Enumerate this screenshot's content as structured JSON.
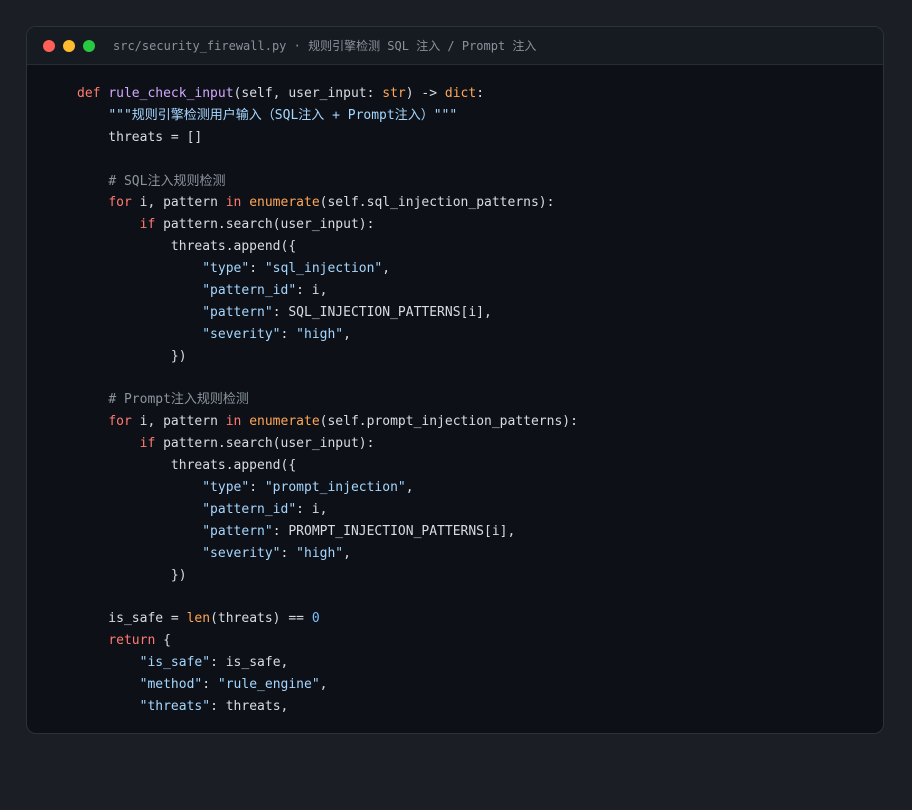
{
  "window": {
    "title": "src/security_firewall.py · 规则引擎检测 SQL 注入 / Prompt 注入",
    "controls": [
      {
        "name": "close-dot",
        "color": "#ff5f57"
      },
      {
        "name": "minimize-dot",
        "color": "#febc2e"
      },
      {
        "name": "maximize-dot",
        "color": "#28c840"
      }
    ]
  },
  "code_lines": [
    [
      [
        "kw",
        "def "
      ],
      [
        "fn",
        "rule_check_input"
      ],
      [
        "id",
        "(self, user_input: "
      ],
      [
        "builtin",
        "str"
      ],
      [
        "id",
        ") -> "
      ],
      [
        "builtin",
        "dict"
      ],
      [
        "id",
        ":"
      ]
    ],
    [
      [
        "id",
        "    "
      ],
      [
        "str",
        "\"\"\"规则引擎检测用户输入（SQL注入 + Prompt注入）\"\"\""
      ]
    ],
    [
      [
        "id",
        "    threats = []"
      ]
    ],
    [],
    [
      [
        "id",
        "    "
      ],
      [
        "cm",
        "# SQL注入规则检测"
      ]
    ],
    [
      [
        "id",
        "    "
      ],
      [
        "kw",
        "for"
      ],
      [
        "id",
        " i, pattern "
      ],
      [
        "kw",
        "in"
      ],
      [
        "id",
        " "
      ],
      [
        "builtin",
        "enumerate"
      ],
      [
        "id",
        "(self.sql_injection_patterns):"
      ]
    ],
    [
      [
        "id",
        "        "
      ],
      [
        "kw",
        "if"
      ],
      [
        "id",
        " pattern.search(user_input):"
      ]
    ],
    [
      [
        "id",
        "            threats.append({"
      ]
    ],
    [
      [
        "id",
        "                "
      ],
      [
        "str",
        "\"type\""
      ],
      [
        "id",
        ": "
      ],
      [
        "str",
        "\"sql_injection\""
      ],
      [
        "id",
        ","
      ]
    ],
    [
      [
        "id",
        "                "
      ],
      [
        "str",
        "\"pattern_id\""
      ],
      [
        "id",
        ": i,"
      ]
    ],
    [
      [
        "id",
        "                "
      ],
      [
        "str",
        "\"pattern\""
      ],
      [
        "id",
        ": SQL_INJECTION_PATTERNS[i],"
      ]
    ],
    [
      [
        "id",
        "                "
      ],
      [
        "str",
        "\"severity\""
      ],
      [
        "id",
        ": "
      ],
      [
        "str",
        "\"high\""
      ],
      [
        "id",
        ","
      ]
    ],
    [
      [
        "id",
        "            })"
      ]
    ],
    [],
    [
      [
        "id",
        "    "
      ],
      [
        "cm",
        "# Prompt注入规则检测"
      ]
    ],
    [
      [
        "id",
        "    "
      ],
      [
        "kw",
        "for"
      ],
      [
        "id",
        " i, pattern "
      ],
      [
        "kw",
        "in"
      ],
      [
        "id",
        " "
      ],
      [
        "builtin",
        "enumerate"
      ],
      [
        "id",
        "(self.prompt_injection_patterns):"
      ]
    ],
    [
      [
        "id",
        "        "
      ],
      [
        "kw",
        "if"
      ],
      [
        "id",
        " pattern.search(user_input):"
      ]
    ],
    [
      [
        "id",
        "            threats.append({"
      ]
    ],
    [
      [
        "id",
        "                "
      ],
      [
        "str",
        "\"type\""
      ],
      [
        "id",
        ": "
      ],
      [
        "str",
        "\"prompt_injection\""
      ],
      [
        "id",
        ","
      ]
    ],
    [
      [
        "id",
        "                "
      ],
      [
        "str",
        "\"pattern_id\""
      ],
      [
        "id",
        ": i,"
      ]
    ],
    [
      [
        "id",
        "                "
      ],
      [
        "str",
        "\"pattern\""
      ],
      [
        "id",
        ": PROMPT_INJECTION_PATTERNS[i],"
      ]
    ],
    [
      [
        "id",
        "                "
      ],
      [
        "str",
        "\"severity\""
      ],
      [
        "id",
        ": "
      ],
      [
        "str",
        "\"high\""
      ],
      [
        "id",
        ","
      ]
    ],
    [
      [
        "id",
        "            })"
      ]
    ],
    [],
    [
      [
        "id",
        "    is_safe = "
      ],
      [
        "builtin",
        "len"
      ],
      [
        "id",
        "(threats) == "
      ],
      [
        "num",
        "0"
      ]
    ],
    [
      [
        "id",
        "    "
      ],
      [
        "kw",
        "return"
      ],
      [
        "id",
        " {"
      ]
    ],
    [
      [
        "id",
        "        "
      ],
      [
        "str",
        "\"is_safe\""
      ],
      [
        "id",
        ": is_safe,"
      ]
    ],
    [
      [
        "id",
        "        "
      ],
      [
        "str",
        "\"method\""
      ],
      [
        "id",
        ": "
      ],
      [
        "str",
        "\"rule_engine\""
      ],
      [
        "id",
        ","
      ]
    ],
    [
      [
        "id",
        "        "
      ],
      [
        "str",
        "\"threats\""
      ],
      [
        "id",
        ": threats,"
      ]
    ]
  ]
}
